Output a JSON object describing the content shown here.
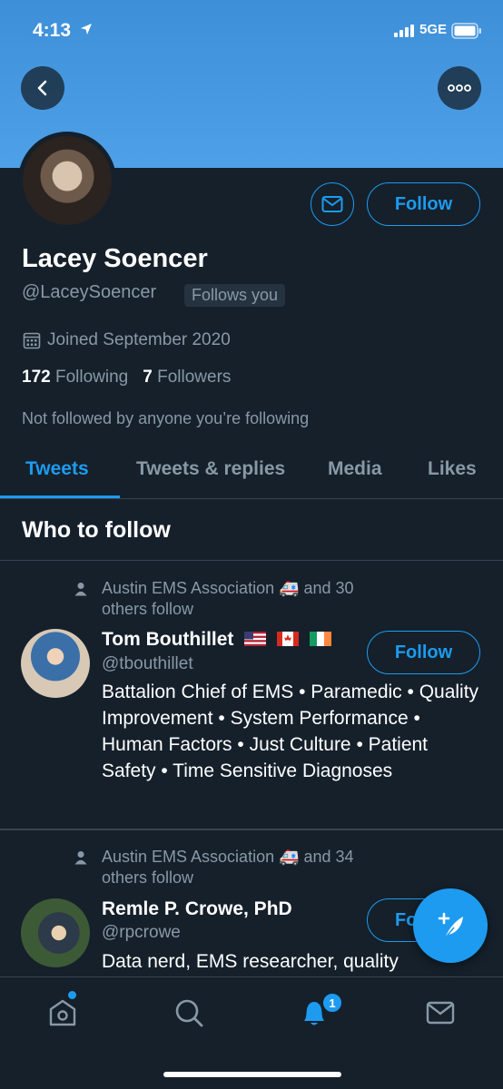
{
  "status_bar": {
    "time": "4:13",
    "network": "5GE"
  },
  "profile": {
    "name": "Lacey Soencer",
    "handle": "@LaceySoencer",
    "follows_you": "Follows you",
    "joined": "Joined September 2020",
    "following_count": "172",
    "following_label": "Following",
    "followers_count": "7",
    "followers_label": "Followers",
    "not_followed": "Not followed by anyone you’re following",
    "follow_label": "Follow"
  },
  "tabs": [
    {
      "label": "Tweets",
      "active": true
    },
    {
      "label": "Tweets & replies",
      "active": false
    },
    {
      "label": "Media",
      "active": false
    },
    {
      "label": "Likes",
      "active": false
    }
  ],
  "who_to_follow": {
    "title": "Who to follow",
    "suggestions": [
      {
        "context_line1": "Austin EMS Association 🚑 and 30",
        "context_line2": "others follow",
        "name": "Tom Bouthillet",
        "handle": "@tbouthillet",
        "bio": "Battalion Chief of EMS • Paramedic • Quality Improvement • System Performance • Human Factors • Just Culture • Patient Safety • Time Sensitive Diagnoses",
        "follow_label": "Follow"
      },
      {
        "context_line1": "Austin EMS Association 🚑 and 34",
        "context_line2": "others follow",
        "name": "Remle P. Crowe, PhD",
        "handle": "@rpcrowe",
        "bio": "Data nerd, EMS researcher, quality",
        "follow_label": "Fo"
      }
    ]
  },
  "bottom_nav": {
    "items": [
      "home-icon",
      "search-icon",
      "notifications-icon",
      "messages-icon"
    ],
    "notification_badge": "1"
  },
  "colors": {
    "accent": "#1d9bf0",
    "background": "#15202b",
    "banner": "#4ea0e8",
    "muted_text": "#8899a6"
  }
}
